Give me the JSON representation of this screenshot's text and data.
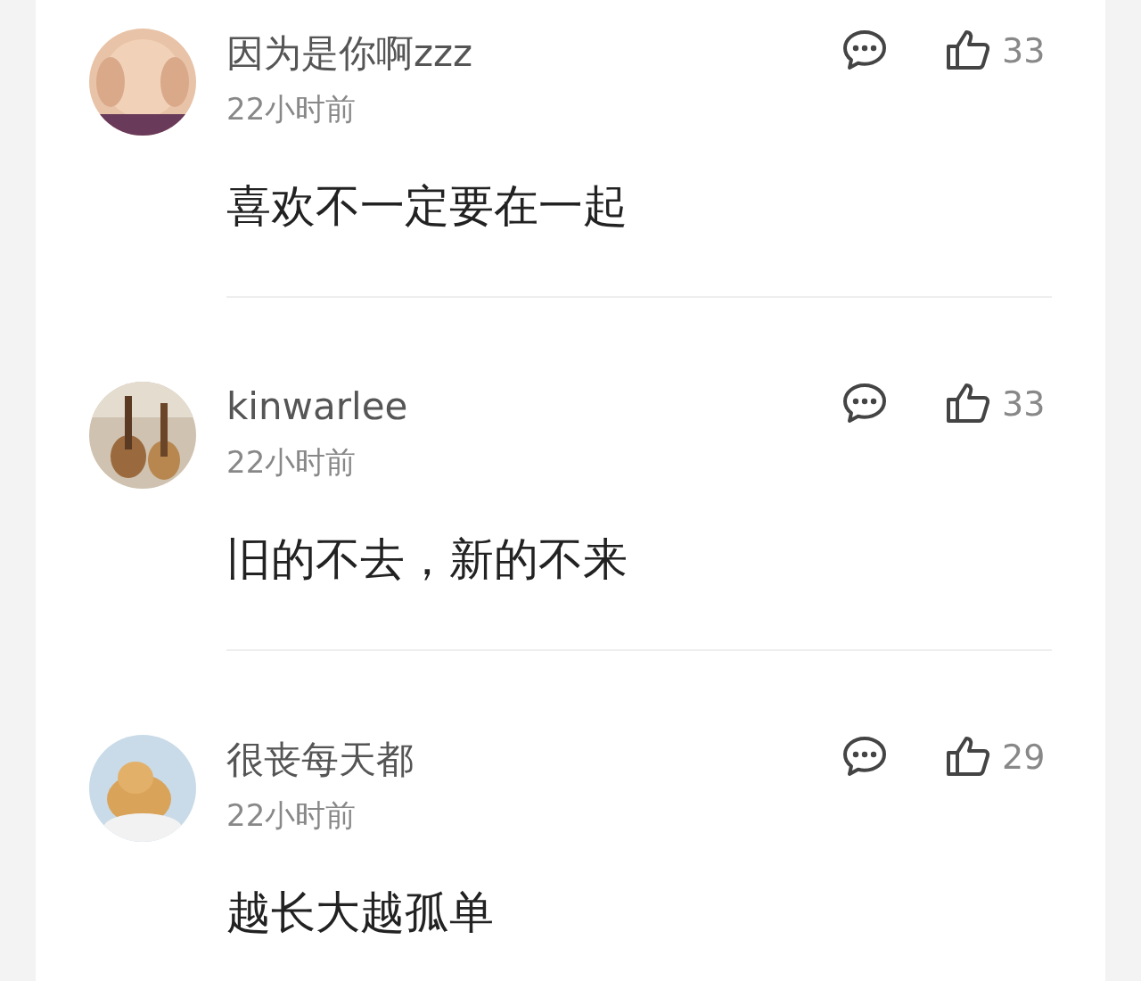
{
  "comments": [
    {
      "name": "因为是你啊zzz",
      "time": "22小时前",
      "text": "喜欢不一定要在一起",
      "likes": "33"
    },
    {
      "name": "kinwarlee",
      "time": "22小时前",
      "text": "旧的不去，新的不来",
      "likes": "33"
    },
    {
      "name": "很丧每天都",
      "time": "22小时前",
      "text": "越长大越孤单",
      "likes": "29"
    }
  ]
}
